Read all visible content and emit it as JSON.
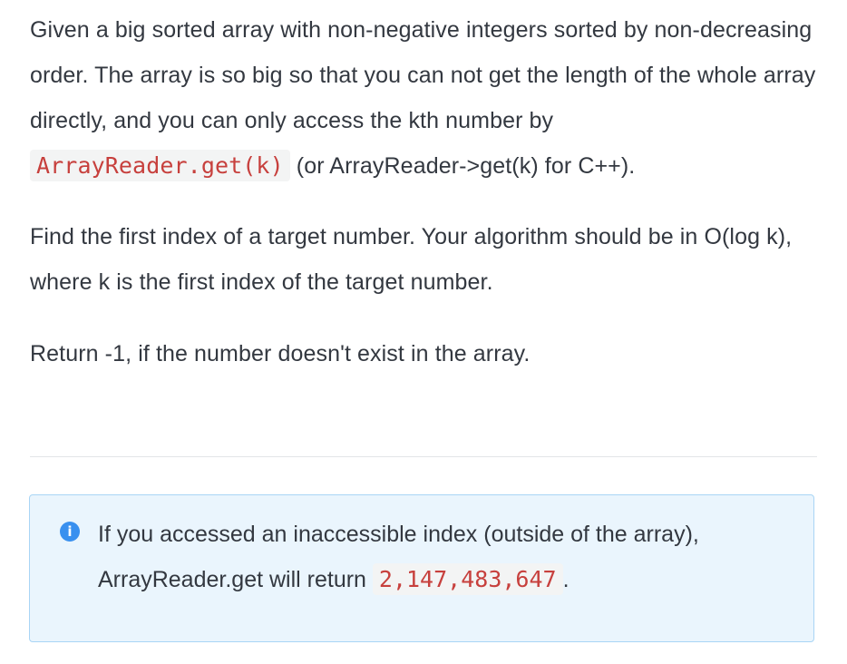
{
  "problem": {
    "p1_a": "Given a big sorted array with non-negative integers sorted by non-decreasing order. The array is so big so that you can not get the length of the whole array directly, and you can only access the kth number by ",
    "p1_code": "ArrayReader.get(k)",
    "p1_b": " (or ArrayReader->get(k) for C++).",
    "p2": "Find the first index of a target number. Your algorithm should be in O(log k), where k is the first index of the target number.",
    "p3": "Return -1, if the number doesn't exist in the array."
  },
  "note": {
    "icon": "info-icon",
    "icon_glyph": "i",
    "icon_color": "#3990ef",
    "text_a": "If you accessed an inaccessible index (outside of the array), ArrayReader.get will return ",
    "code": "2,147,483,647",
    "text_b": "."
  },
  "colors": {
    "code_text": "#c7403d",
    "code_background": "#f3f4f4",
    "note_background": "#eaf5fd",
    "note_border": "#a9d5f5"
  }
}
